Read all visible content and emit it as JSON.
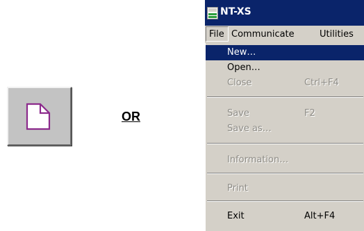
{
  "or_label": "OR",
  "window": {
    "title": "NT-XS",
    "menubar": [
      "File",
      "Communicate",
      "Utilities"
    ],
    "file_menu": {
      "new": {
        "label": "New…",
        "shortcut": ""
      },
      "open": {
        "label": "Open…",
        "shortcut": ""
      },
      "close": {
        "label": "Close",
        "shortcut": "Ctrl+F4"
      },
      "save": {
        "label": "Save",
        "shortcut": "F2"
      },
      "save_as": {
        "label": "Save as…",
        "shortcut": ""
      },
      "information": {
        "label": "Information…",
        "shortcut": ""
      },
      "print": {
        "label": "Print",
        "shortcut": ""
      },
      "exit": {
        "label": "Exit",
        "shortcut": "Alt+F4"
      }
    }
  },
  "icons": {
    "new_button": "new-document-icon",
    "app": "app-window-icon"
  },
  "colors": {
    "selection": "#0a246a",
    "menu_bg": "#d4d0c8",
    "disabled": "#8e8c86",
    "doc_outline": "#8c2a8c"
  }
}
